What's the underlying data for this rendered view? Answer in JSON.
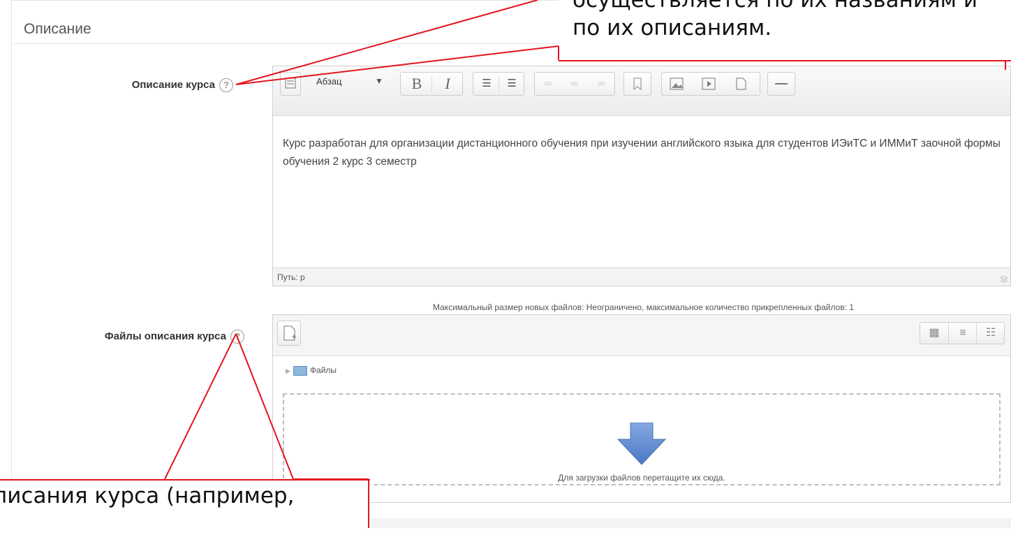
{
  "section": {
    "legend": "Описание"
  },
  "course_description": {
    "label": "Описание курса",
    "help_icon": "?",
    "editor": {
      "paragraph_format": "Абзац",
      "text": "Курс разработан для организации дистанционного обучения при изучении английского языка для студентов ИЭиТС и ИММиТ заочной формы обучения 2 курс 3 семестр",
      "path": "Путь: p"
    }
  },
  "course_files": {
    "label": "Файлы описания курса",
    "help_icon": "?",
    "limits_text": "Максимальный размер новых файлов: Неограничено, максимальное количество прикрепленных файлов: 1",
    "folder_label": "Файлы",
    "drop_text": "Для загрузки файлов перетащите их сюда."
  },
  "callouts": {
    "top_line1": "осуществляется по их названиям и",
    "top_line2": "по их описаниям.",
    "bottom_text": "писания курса (например,"
  },
  "colors": {
    "callout_line": "#e3141c",
    "arrow_blue": "#5b86cf"
  },
  "icons": {
    "toolbar": [
      "toggle-toolbar-icon",
      "dropdown-caret-icon",
      "bold-icon",
      "italic-icon",
      "bullet-list-icon",
      "numbered-list-icon",
      "link-icon",
      "unlink-icon",
      "anchor-link-icon",
      "bookmark-icon",
      "image-icon",
      "media-icon",
      "file-icon",
      "horizontal-rule-icon"
    ]
  }
}
